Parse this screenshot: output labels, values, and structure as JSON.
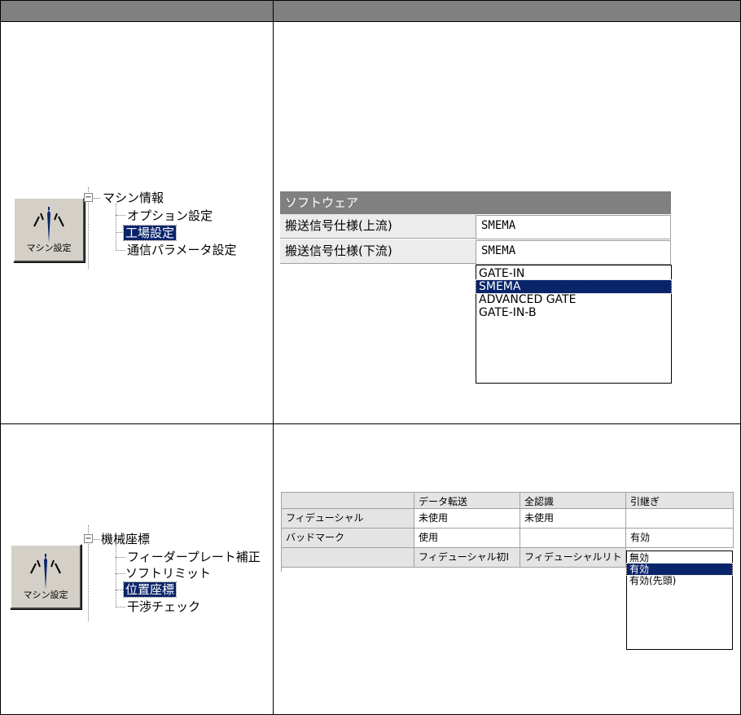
{
  "button": {
    "label": "マシン設定"
  },
  "top": {
    "tree": {
      "root": "マシン情報",
      "children": [
        "オプション設定",
        "工場設定",
        "通信パラメータ設定"
      ],
      "selected_index": 1
    },
    "grid": {
      "header": "ソフトウェア",
      "rows": [
        {
          "label": "搬送信号仕様(上流)",
          "value": "SMEMA"
        },
        {
          "label": "搬送信号仕様(下流)",
          "value": "SMEMA"
        }
      ]
    },
    "dropdown": {
      "options": [
        "GATE-IN",
        "SMEMA",
        "ADVANCED GATE",
        "GATE-IN-B"
      ],
      "selected": "SMEMA"
    }
  },
  "bottom": {
    "tree": {
      "root": "機械座標",
      "children": [
        "フィーダープレート補正",
        "ソフトリミット",
        "位置座標",
        "干渉チェック"
      ],
      "selected_index": 2
    },
    "grid": {
      "columns": [
        "",
        "データ転送",
        "全認識",
        "引継ぎ"
      ],
      "rows": [
        [
          "フィデューシャル",
          "未使用",
          "未使用",
          ""
        ],
        [
          "バッドマーク",
          "使用",
          "",
          "有効"
        ],
        [
          "",
          "フィデューシャル初I",
          "フィデューシャルリト",
          ""
        ]
      ]
    },
    "dropdown": {
      "options": [
        "無効",
        "有効",
        "有効(先頭)"
      ],
      "selected": "有効"
    }
  },
  "colors": {
    "selection": "#0a246a",
    "header": "#808080"
  }
}
